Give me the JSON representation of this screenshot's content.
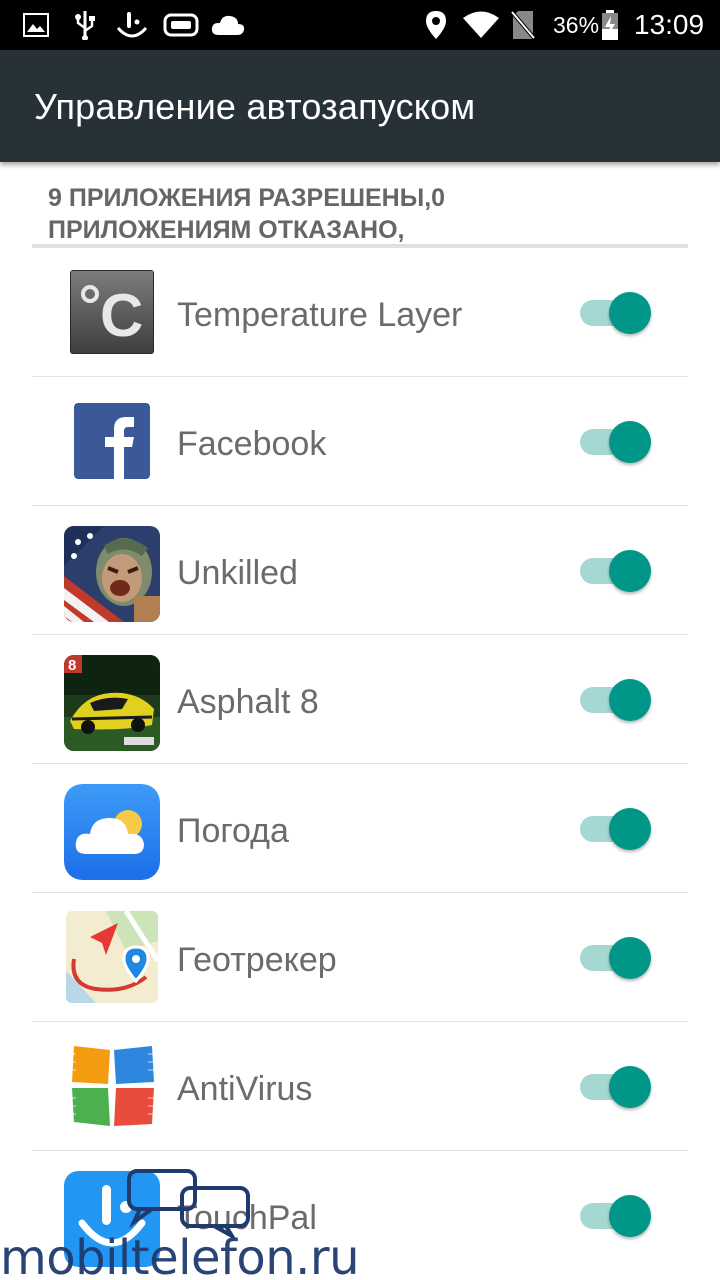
{
  "status_bar": {
    "battery_percent": "36%",
    "clock": "13:09",
    "icons_left": [
      "gallery-icon",
      "usb-icon",
      "touchpal-icon",
      "gamepad-icon",
      "cloud-icon"
    ],
    "icons_right": [
      "location-icon",
      "wifi-icon",
      "no-sim-icon",
      "battery-charging-icon"
    ]
  },
  "toolbar": {
    "title": "Управление автозапуском"
  },
  "summary": {
    "line1": "9 ПРИЛОЖЕНИЯ РАЗРЕШЕНЫ,0",
    "line2": "ПРИЛОЖЕНИЯМ ОТКАЗАНО,"
  },
  "apps": [
    {
      "name": "Temperature Layer",
      "icon": "temperature-layer-icon",
      "enabled": true
    },
    {
      "name": "Facebook",
      "icon": "facebook-icon",
      "enabled": true
    },
    {
      "name": "Unkilled",
      "icon": "unkilled-icon",
      "enabled": true
    },
    {
      "name": "Asphalt 8",
      "icon": "asphalt-8-icon",
      "enabled": true
    },
    {
      "name": "Погода",
      "icon": "weather-icon",
      "enabled": true
    },
    {
      "name": "Геотрекер",
      "icon": "geotracker-icon",
      "enabled": true
    },
    {
      "name": "AntiVirus",
      "icon": "antivirus-icon",
      "enabled": true
    },
    {
      "name": "TouchPal",
      "icon": "touchpal-icon",
      "enabled": true
    }
  ],
  "colors": {
    "toolbar": "#263238",
    "toggle_thumb": "#009688",
    "toggle_track": "#a6d8d3"
  },
  "watermark": {
    "text": "mobiltelefon.ru"
  }
}
